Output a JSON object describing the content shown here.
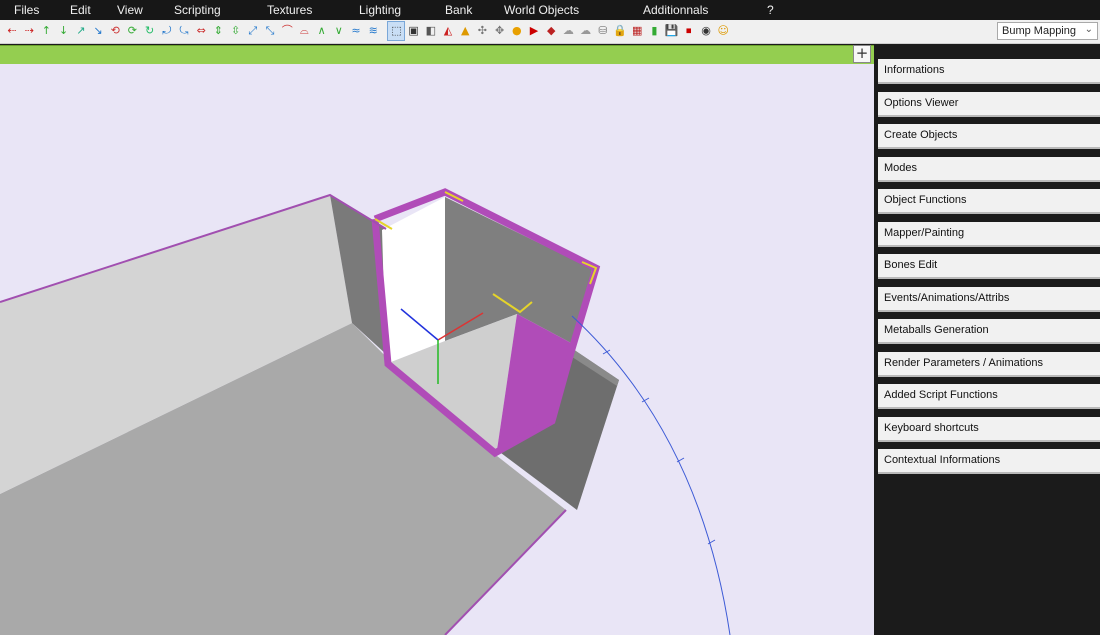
{
  "menu": [
    "Files",
    "Edit",
    "View",
    "Scripting",
    "Textures",
    "Lighting",
    "Bank",
    "World Objects",
    "Additionnals",
    "?"
  ],
  "toolbar": {
    "icons": [
      "arrow-left-icon",
      "arrow-right-icon",
      "move-y-icon",
      "move-y-down-icon",
      "move-z-icon",
      "move-z-alt-icon",
      "rotate-x-icon",
      "rotate-y-icon",
      "rotate-y-alt-icon",
      "rotate-z-icon",
      "rotate-z-alt-icon",
      "scale-x-icon",
      "scale-y-icon",
      "scale-y-alt-icon",
      "scale-z-icon",
      "scale-z-alt-icon",
      "bend-icon",
      "bend-alt-icon",
      "taper-icon",
      "taper-alt-icon",
      "twist-icon",
      "twist-alt-icon",
      "select-icon",
      "cube-select-icon",
      "cube-icon",
      "prism-icon",
      "cone-icon",
      "vertex-icon",
      "snap-icon",
      "light-bulb-icon",
      "play-icon",
      "paint-icon",
      "cloud-icon",
      "cloud-alt-icon",
      "bucket-icon",
      "lock-icon",
      "texture-icon",
      "bottle-icon",
      "save-icon",
      "stop-icon",
      "camera-icon",
      "smile-icon"
    ],
    "render_mode": "Bump Mapping"
  },
  "green_bar": {
    "plus_label": "+"
  },
  "panel": [
    "Informations",
    "Options Viewer",
    "Create Objects",
    "Modes",
    "Object Functions",
    "Mapper/Painting",
    "Bones Edit",
    "Events/Animations/Attribs",
    "Metaballs Generation",
    "Render Parameters / Animations",
    "Added Script Functions",
    "Keyboard shortcuts",
    "Contextual Informations"
  ]
}
